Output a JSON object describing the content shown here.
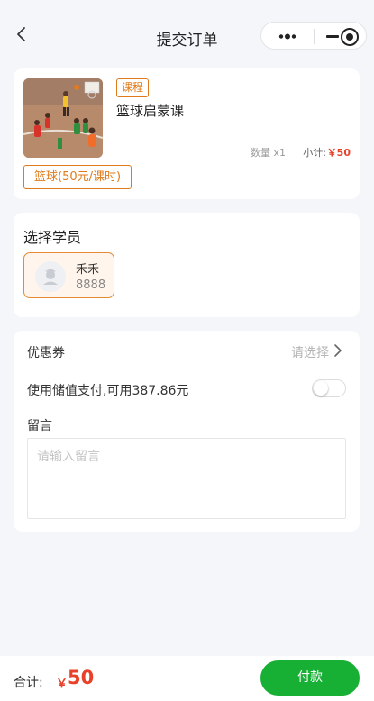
{
  "header": {
    "title": "提交订单"
  },
  "product": {
    "tag": "课程",
    "name": "篮球启蒙课",
    "quantity": "数量 x1",
    "subtotal_label": "小计:",
    "subtotal_value": "￥50",
    "spec": "篮球(50元/课时)"
  },
  "student": {
    "section_title": "选择学员",
    "name": "禾禾",
    "id": "8888"
  },
  "options": {
    "coupon_label": "优惠券",
    "coupon_value": "请选择",
    "balance_label": "使用储值支付,可用387.86元",
    "balance_enabled": false,
    "message_label": "留言",
    "message_placeholder": "请输入留言",
    "message_value": ""
  },
  "footer": {
    "total_label": "合计:",
    "currency": "￥",
    "total_value": "50",
    "pay_label": "付款"
  },
  "colors": {
    "accent_orange": "#e07a1a",
    "price_red": "#e8412a",
    "pay_green": "#17b035"
  }
}
